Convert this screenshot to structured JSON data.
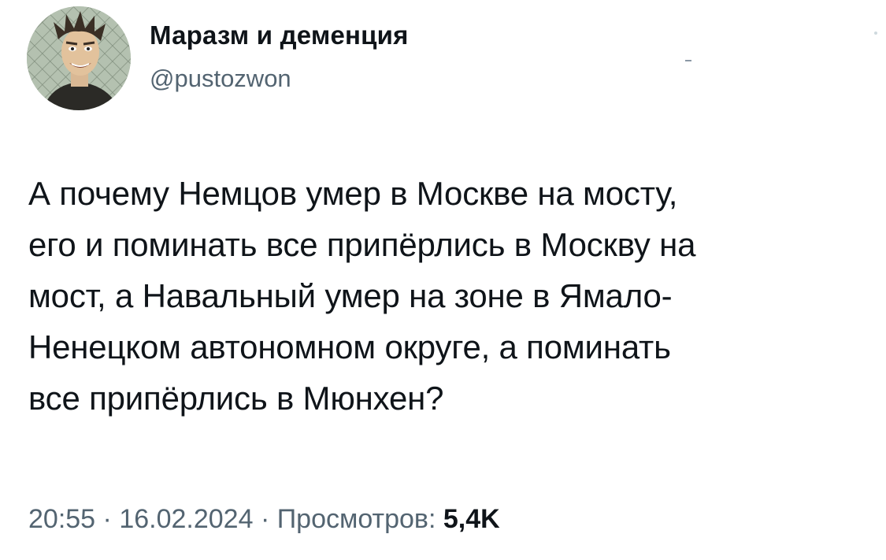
{
  "author": {
    "display_name": "Маразм и деменция",
    "handle": "@pustozwon",
    "avatar_icon": "profile-photo-avatar"
  },
  "tweet": {
    "text": "А почему Немцов умер в Москве на мосту,\nего и поминать все припёрлись в Москву на\nмост, а Навальный умер на зоне в Ямало-\nНенецком автономном округе, а поминать\nвсе припёрлись в Мюнхен?",
    "time": "20:55",
    "separator": "·",
    "date": "16.02.2024",
    "views_label": "Просмотров:",
    "views_count": "5,4K"
  },
  "colors": {
    "text": "#0f1419",
    "secondary": "#536471",
    "background": "#ffffff"
  }
}
